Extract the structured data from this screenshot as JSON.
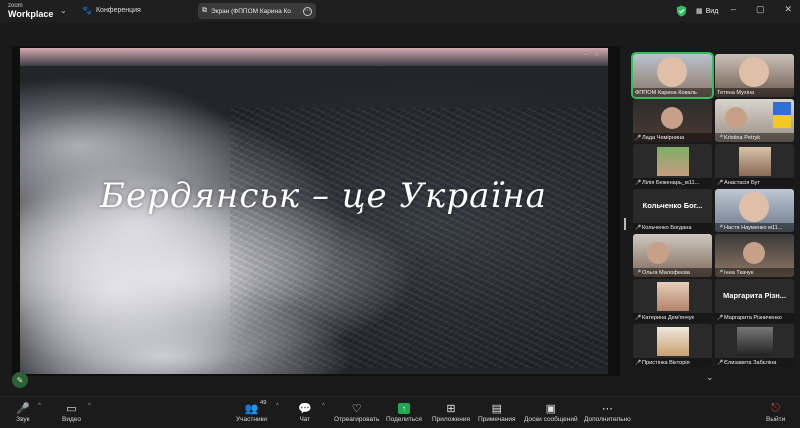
{
  "app": {
    "logo_line1": "zoom",
    "logo_line2": "Workplace",
    "meeting_label": "Конференция",
    "screen_share_chip": "Экран (ФППОМ Карина Ко",
    "view_label": "Вид"
  },
  "shared_screen": {
    "overlay_title": "Бердянськ – це Україна"
  },
  "gallery": {
    "tiles": [
      {
        "name": "ФППОМ Карина Коваль",
        "active": true,
        "muted": false
      },
      {
        "name": "Тетяна Мухіна",
        "active": false,
        "muted": false
      },
      {
        "name": "Лада Чемірнина",
        "active": false,
        "muted": true
      },
      {
        "name": "Kristina Petryk",
        "active": false,
        "muted": true
      },
      {
        "name": "Лілія Беженарь_м11...",
        "active": false,
        "muted": true
      },
      {
        "name": "Анастасія Бут",
        "active": false,
        "muted": true
      },
      {
        "name": "Кольченко Богдана",
        "active": false,
        "muted": true,
        "big": "Кольченко Бог..."
      },
      {
        "name": "Настя Науменко м11...",
        "active": false,
        "muted": true
      },
      {
        "name": "Ольга Малофеєва",
        "active": false,
        "muted": true
      },
      {
        "name": "Інна Ткачук",
        "active": false,
        "muted": true
      },
      {
        "name": "Катерина Дем'янчук",
        "active": false,
        "muted": true
      },
      {
        "name": "Маргарита Різниченко",
        "active": false,
        "muted": true,
        "big": "Маргарита Різн..."
      },
      {
        "name": "Пристінка Вікторія",
        "active": false,
        "muted": true
      },
      {
        "name": "Єлизавета Забєліна",
        "active": false,
        "muted": true
      }
    ]
  },
  "toolbar": {
    "audio": "Звук",
    "video": "Видео",
    "participants": "Участники",
    "participants_count": "49",
    "chat": "Чат",
    "react": "Отреагировать",
    "share": "Поделиться",
    "apps": "Приложения",
    "notes": "Примечания",
    "whiteboards": "Доски сообщений",
    "more": "Дополнительно",
    "leave": "Выйти"
  },
  "colors": {
    "active_speaker": "#2fbf5e",
    "share_button": "#1fa84f",
    "muted_mic": "#e0463f"
  }
}
